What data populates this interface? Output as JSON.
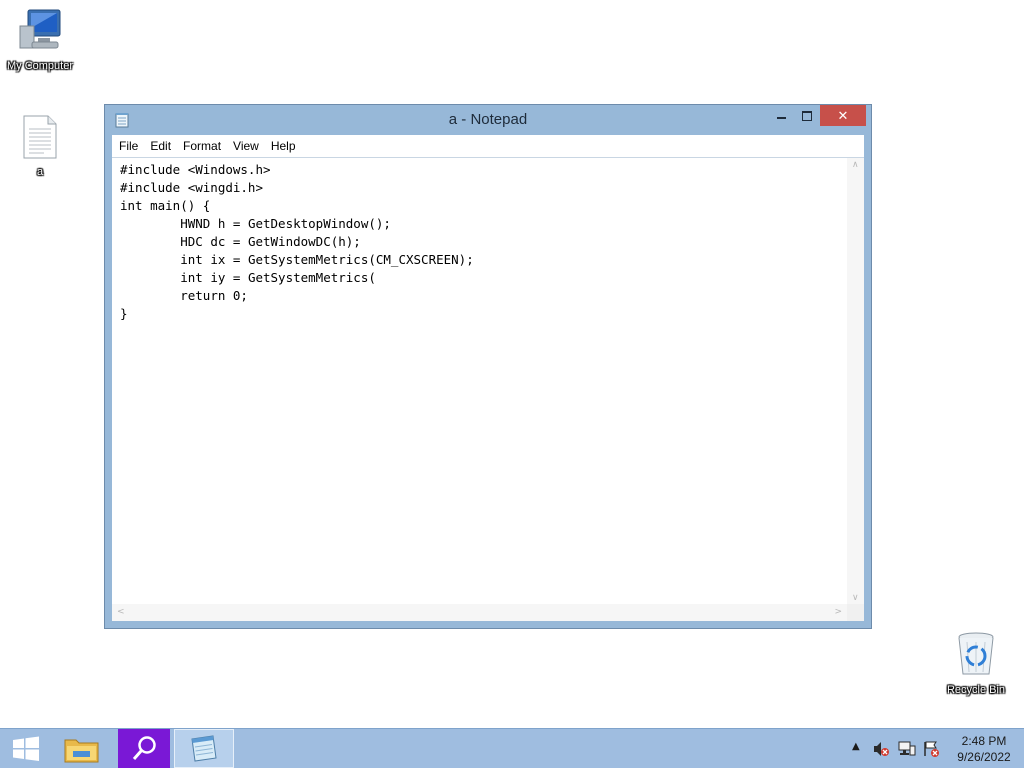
{
  "desktop": {
    "icons": {
      "my_computer": "My Computer",
      "file_a": "a",
      "recycle_bin": "Recycle Bin"
    }
  },
  "window": {
    "title": "a - Notepad",
    "close_glyph": "✕",
    "menu": [
      "File",
      "Edit",
      "Format",
      "View",
      "Help"
    ],
    "content": "#include <Windows.h>\n#include <wingdi.h>\nint main() {\n\tHWND h = GetDesktopWindow();\n\tHDC dc = GetWindowDC(h);\n\tint ix = GetSystemMetrics(CM_CXSCREEN);\n\tint iy = GetSystemMetrics(\n\treturn 0;\n}"
  },
  "taskbar": {
    "clock_time": "2:48 PM",
    "clock_date": "9/26/2022",
    "icons": [
      "windows-start-icon",
      "file-explorer-icon",
      "search-icon",
      "notepad-icon"
    ]
  },
  "tray": {
    "icons": [
      "show-hidden-icons-arrow",
      "volume-muted-icon",
      "network-icon",
      "action-center-icon"
    ]
  },
  "colors": {
    "taskbar": "#9fbde0",
    "window_frame": "#97b8d8",
    "close_button": "#c7504a",
    "search_tile": "#7a18d6"
  }
}
